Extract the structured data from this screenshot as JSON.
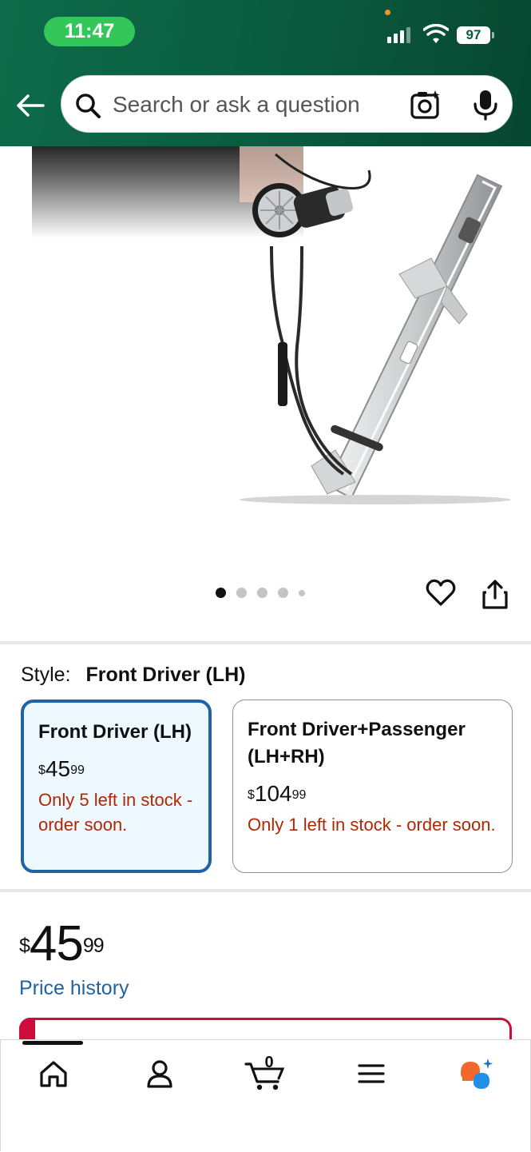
{
  "status_bar": {
    "time": "11:47",
    "battery": "97"
  },
  "search": {
    "placeholder": "Search or ask a question"
  },
  "gallery": {
    "page_count": 5,
    "active_index": 0
  },
  "style": {
    "label": "Style:",
    "selected": "Front Driver (LH)",
    "options": [
      {
        "name": "Front Driver (LH)",
        "currency": "$",
        "whole": "45",
        "fraction": "99",
        "stock": "Only 5 left in stock - order soon."
      },
      {
        "name": "Front Driver+Passenger (LH+RH)",
        "currency": "$",
        "whole": "104",
        "fraction": "99",
        "stock": "Only 1 left in stock - order soon."
      }
    ]
  },
  "price": {
    "currency": "$",
    "whole": "45",
    "fraction": "99",
    "history_link": "Price history"
  },
  "bottom_nav": {
    "cart_count": "0",
    "items": [
      "home-icon",
      "account-icon",
      "cart-icon",
      "menu-icon",
      "rufus-assistant-icon"
    ]
  },
  "colors": {
    "header": "#0a5a3f",
    "link": "#2162a1",
    "stock_warning": "#b12704",
    "selected_border": "#2162a1",
    "selected_bg": "#edf8ff",
    "status_pill": "#33c659"
  }
}
